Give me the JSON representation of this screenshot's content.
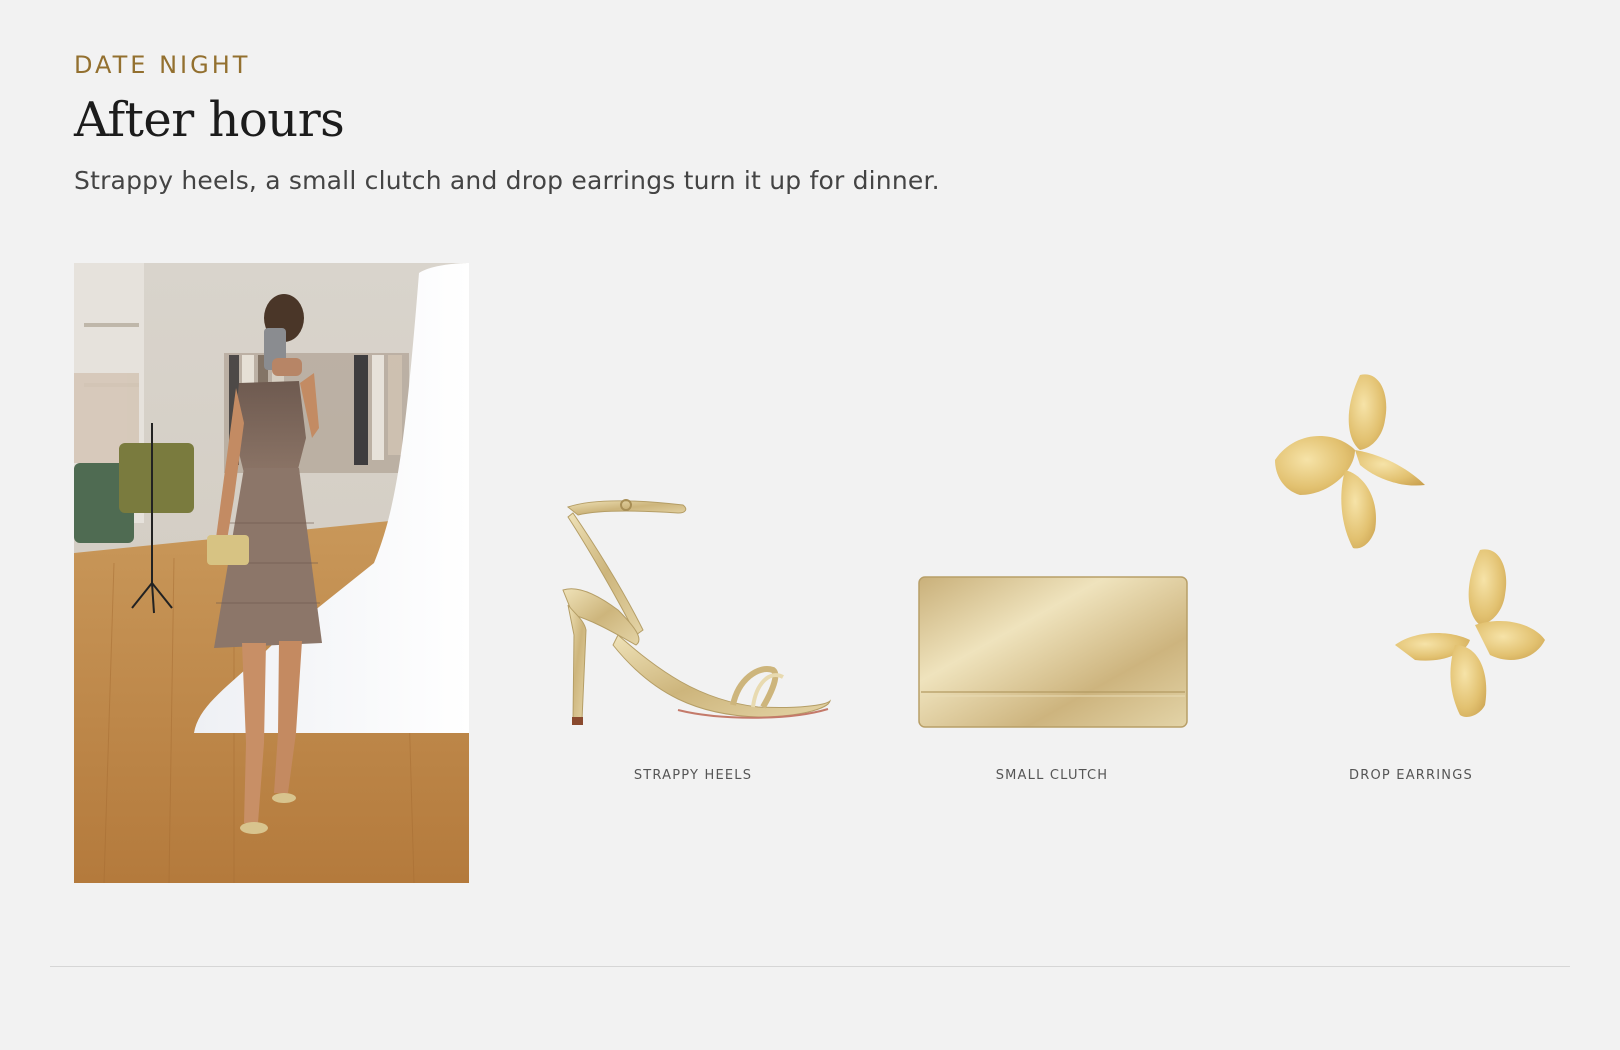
{
  "section": {
    "eyebrow": "DATE NIGHT",
    "title": "After hours",
    "subtitle": "Strappy heels, a small clutch and drop earrings turn it up for dinner."
  },
  "lookbook_photo": {
    "icon": "outfit-photo"
  },
  "products": [
    {
      "label": "STRAPPY HEELS",
      "icon": "strappy-heel-image"
    },
    {
      "label": "SMALL CLUTCH",
      "icon": "clutch-image"
    },
    {
      "label": "DROP EARRINGS",
      "icon": "earrings-image"
    }
  ],
  "colors": {
    "background": "#f2f2f2",
    "eyebrow": "#93702f",
    "title": "#1c1c1c",
    "gold": "#d8c48e"
  }
}
